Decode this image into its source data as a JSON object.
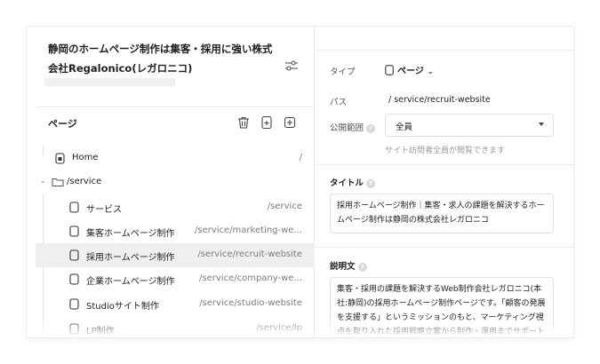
{
  "sidebar": {
    "site_title": "静岡のホームページ制作は集客・採用に強い株式会社Regalonico(レガロニコ)",
    "pages_heading": "ページ",
    "tree": [
      {
        "label": "Home",
        "path": "/",
        "icon": "home-icon"
      },
      {
        "label": "/service",
        "path": "",
        "icon": "folder-icon"
      },
      {
        "label": "サービス",
        "path": "/service",
        "icon": "page-icon"
      },
      {
        "label": "集客ホームページ制作",
        "path": "/service/marketing-we...",
        "icon": "page-icon"
      },
      {
        "label": "採用ホームページ制作",
        "path": "/service/recruit-website",
        "icon": "page-icon",
        "selected": true
      },
      {
        "label": "企業ホームページ制作",
        "path": "/service/company-we...",
        "icon": "page-icon"
      },
      {
        "label": "Studioサイト制作",
        "path": "/service/studio-website",
        "icon": "page-icon"
      },
      {
        "label": "LP制作",
        "path": "/service/lp",
        "icon": "page-icon"
      }
    ]
  },
  "panel": {
    "type_label": "タイプ",
    "type_value": "ページ",
    "path_label": "パス",
    "path_value": "/ service/recruit-website",
    "visibility_label": "公開範囲",
    "visibility_value": "全員",
    "visibility_note": "サイト訪問者全員が閲覧できます",
    "title_label": "タイトル",
    "title_value": "採用ホームページ制作｜集客・求人の課題を解決するホームページ制作は静岡の株式会社レガロニコ",
    "desc_label": "説明文",
    "desc_value": "集客・採用の課題を解決するWeb制作会社レガロニコ(本社:静岡)の採用ホームページ制作ページです。「顧客の発展を支援する」というミッションのもと、マーケティング視点を取り入れた採用戦略立案から制作・運用までサポートします。"
  }
}
